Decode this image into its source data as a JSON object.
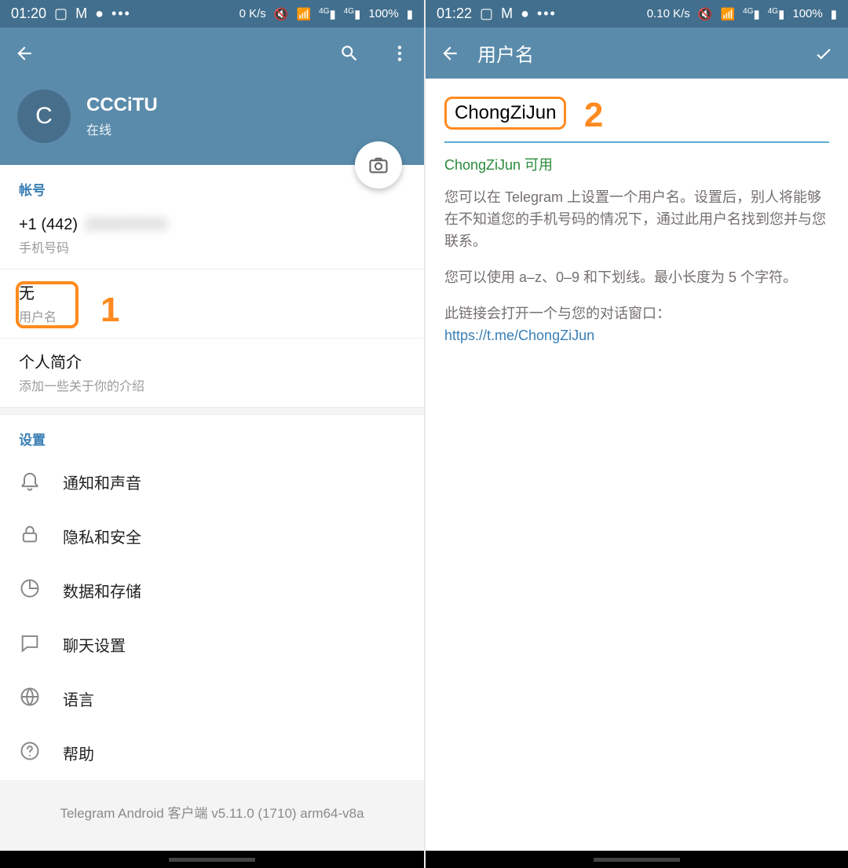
{
  "left": {
    "statusbar": {
      "time": "01:20",
      "net_speed": "0 K/s",
      "battery": "100%"
    },
    "profile": {
      "avatar_letter": "C",
      "name": "CCCiTU",
      "status": "在线"
    },
    "account": {
      "header": "帐号",
      "phone_prefix": "+1 (442)",
      "phone_hidden": "2XXXXXXX",
      "phone_label": "手机号码",
      "username_value": "无",
      "username_label": "用户名",
      "bio_value": "个人简介",
      "bio_label": "添加一些关于你的介绍"
    },
    "settings": {
      "header": "设置",
      "items": [
        "通知和声音",
        "隐私和安全",
        "数据和存储",
        "聊天设置",
        "语言",
        "帮助"
      ]
    },
    "version": "Telegram Android 客户端 v5.11.0 (1710) arm64-v8a",
    "annotation1": "1"
  },
  "right": {
    "statusbar": {
      "time": "01:22",
      "net_speed": "0.10 K/s",
      "battery": "100%"
    },
    "appbar": {
      "title": "用户名"
    },
    "username_value": "ChongZiJun",
    "available_text": "ChongZiJun 可用",
    "desc1": "您可以在 Telegram 上设置一个用户名。设置后，别人将能够在不知道您的手机号码的情况下，通过此用户名找到您并与您联系。",
    "desc2": "您可以使用 a–z、0–9 和下划线。最小长度为 5 个字符。",
    "desc3": "此链接会打开一个与您的对话窗口：",
    "link": "https://t.me/ChongZiJun",
    "annotation2": "2"
  }
}
